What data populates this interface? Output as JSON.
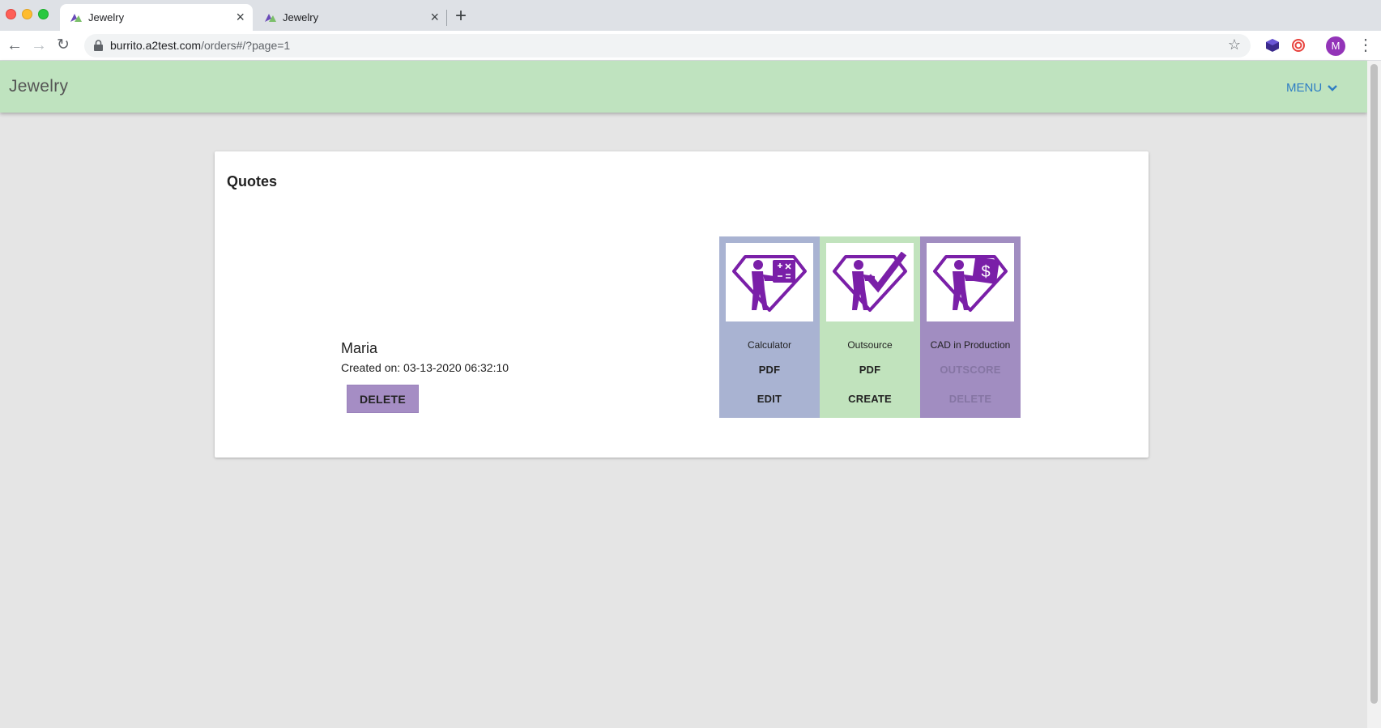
{
  "browser": {
    "tabs": [
      {
        "title": "Jewelry",
        "active": true
      },
      {
        "title": "Jewelry",
        "active": false
      }
    ],
    "new_tab": "+",
    "close_glyph": "×",
    "url_host": "burrito.a2test.com",
    "url_path": "/orders#/?page=1",
    "avatar_initial": "M"
  },
  "header": {
    "brand": "Jewelry",
    "menu_label": "MENU",
    "color": "#bfe3bf",
    "menu_color": "#2f7ec4"
  },
  "quotes": {
    "title": "Quotes",
    "item": {
      "name": "Maria",
      "created": "Created on: 03-13-2020 06:32:10",
      "delete_label": "DELETE"
    },
    "tiles": [
      {
        "icon": "calculator-diamond-icon",
        "label": "Calculator",
        "action1": "PDF",
        "action2": "EDIT",
        "color": "#a9b3d2",
        "disabled": false
      },
      {
        "icon": "checkmark-diamond-icon",
        "label": "Outsource",
        "action1": "PDF",
        "action2": "CREATE",
        "color": "#c1e3bd",
        "disabled": false
      },
      {
        "icon": "dollar-diamond-icon",
        "label": "CAD in Production",
        "action1": "OUTSCORE",
        "action2": "DELETE",
        "color": "#a18dc1",
        "disabled": true
      }
    ]
  },
  "colors": {
    "icon_purple": "#7a1fa8",
    "delete_button": "#a58dc4"
  }
}
